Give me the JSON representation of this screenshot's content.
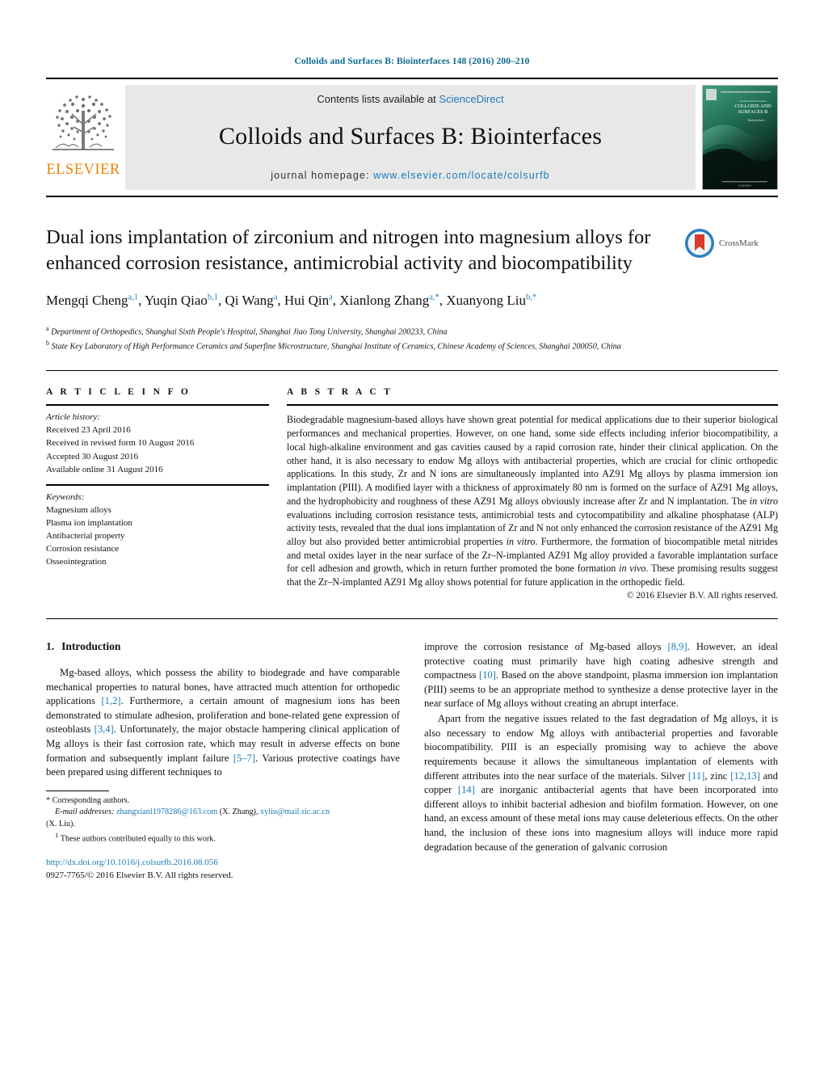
{
  "running_head": "Colloids and Surfaces B: Biointerfaces 148 (2016) 200–210",
  "masthead": {
    "publisher_name": "ELSEVIER",
    "contents_prefix": "Contents lists available at ",
    "contents_link": "ScienceDirect",
    "journal_name": "Colloids and Surfaces B: Biointerfaces",
    "homepage_prefix": "journal homepage: ",
    "homepage_url": "www.elsevier.com/locate/colsurfb",
    "cover_title_line1": "COLLOIDS AND",
    "cover_title_line2": "SURFACES B",
    "link_color": "#1a7bb9",
    "band_color": "#e8e8e8",
    "elsevier_orange": "#ef8200",
    "cover_green": "#0d3c2d"
  },
  "article": {
    "title": "Dual ions implantation of zirconium and nitrogen into magnesium alloys for enhanced corrosion resistance, antimicrobial activity and biocompatibility",
    "crossmark_label": "CrossMark",
    "authors": [
      {
        "name": "Mengqi Cheng",
        "marks": "a,1",
        "sep": ", "
      },
      {
        "name": "Yuqin Qiao",
        "marks": "b,1",
        "sep": ", "
      },
      {
        "name": "Qi Wang",
        "marks": "a",
        "sep": ", "
      },
      {
        "name": "Hui Qin",
        "marks": "a",
        "sep": ", "
      },
      {
        "name": "Xianlong Zhang",
        "marks": "a,*",
        "sep": ", "
      },
      {
        "name": "Xuanyong Liu",
        "marks": "b,*",
        "sep": ""
      }
    ],
    "affiliations": [
      {
        "mark": "a",
        "text": "Department of Orthopedics, Shanghai Sixth People's Hospital, Shanghai Jiao Tong University, Shanghai 200233, China"
      },
      {
        "mark": "b",
        "text": "State Key Laboratory of High Performance Ceramics and Superfine Microstructure, Shanghai Institute of Ceramics, Chinese Academy of Sciences, Shanghai 200050, China"
      }
    ]
  },
  "article_info": {
    "heading": "A R T I C L E    I N F O",
    "history_label": "Article history:",
    "history": [
      "Received 23 April 2016",
      "Received in revised form 10 August 2016",
      "Accepted 30 August 2016",
      "Available online 31 August 2016"
    ],
    "keywords_label": "Keywords:",
    "keywords": [
      "Magnesium alloys",
      "Plasma ion implantation",
      "Antibacterial property",
      "Corrosion resistance",
      "Osseointegration"
    ]
  },
  "abstract": {
    "heading": "A B S T R A C T",
    "paragraphs": [
      "Biodegradable magnesium-based alloys have shown great potential for medical applications due to their superior biological performances and mechanical properties. However, on one hand, some side effects including inferior biocompatibility, a local high-alkaline environment and gas cavities caused by a rapid corrosion rate, hinder their clinical application. On the other hand, it is also necessary to endow Mg alloys with antibacterial properties, which are crucial for clinic orthopedic applications. In this study, Zr and N ions are simultaneously implanted into AZ91 Mg alloys by plasma immersion ion implantation (PIII). A modified layer with a thickness of approximately 80 nm is formed on the surface of AZ91 Mg alloys, and the hydrophobicity and roughness of these AZ91 Mg alloys obviously increase after Zr and N implantation. The in vitro evaluations including corrosion resistance tests, antimicrobial tests and cytocompatibility and alkaline phosphatase (ALP) activity tests, revealed that the dual ions implantation of Zr and N not only enhanced the corrosion resistance of the AZ91 Mg alloy but also provided better antimicrobial properties in vitro. Furthermore, the formation of biocompatible metal nitrides and metal oxides layer in the near surface of the Zr–N-implanted AZ91 Mg alloy provided a favorable implantation surface for cell adhesion and growth, which in return further promoted the bone formation in vivo. These promising results suggest that the Zr–N-implanted AZ91 Mg alloy shows potential for future application in the orthopedic field."
    ],
    "copyright": "© 2016 Elsevier B.V. All rights reserved."
  },
  "body": {
    "section_number": "1.",
    "section_title": "Introduction",
    "left_paragraphs": [
      "Mg-based alloys, which possess the ability to biodegrade and have comparable mechanical properties to natural bones, have attracted much attention for orthopedic applications [1,2]. Furthermore, a certain amount of magnesium ions has been demonstrated to stimulate adhesion, proliferation and bone-related gene expression of osteoblasts [3,4]. Unfortunately, the major obstacle hampering clinical application of Mg alloys is their fast corrosion rate, which may result in adverse effects on bone formation and subsequently implant failure [5–7]. Various protective coatings have been prepared using different techniques to"
    ],
    "right_paragraphs": [
      "improve the corrosion resistance of Mg-based alloys [8,9]. However, an ideal protective coating must primarily have high coating adhesive strength and compactness [10]. Based on the above standpoint, plasma immersion ion implantation (PIII) seems to be an appropriate method to synthesize a dense protective layer in the near surface of Mg alloys without creating an abrupt interface.",
      "Apart from the negative issues related to the fast degradation of Mg alloys, it is also necessary to endow Mg alloys with antibacterial properties and favorable biocompatibility. PIII is an especially promising way to achieve the above requirements because it allows the simultaneous implantation of elements with different attributes into the near surface of the materials. Silver [11], zinc [12,13] and copper [14] are inorganic antibacterial agents that have been incorporated into different alloys to inhibit bacterial adhesion and biofilm formation. However, on one hand, an excess amount of these metal ions may cause deleterious effects. On the other hand, the inclusion of these ions into magnesium alloys will induce more rapid degradation because of the generation of galvanic corrosion"
    ]
  },
  "footnotes": {
    "corresponding_label": "Corresponding authors.",
    "email_label": "E-mail addresses:",
    "email1": "zhangxianl1978286@163.com",
    "email1_owner": "(X. Zhang),",
    "email2": "xyliu@mail.sic.ac.cn",
    "email2_owner": "(X. Liu).",
    "equal_contrib_marker": "1",
    "equal_contrib": "These authors contributed equally to this work.",
    "doi": "http://dx.doi.org/10.1016/j.colsurfb.2016.08.056",
    "issn_line": "0927-7765/© 2016 Elsevier B.V. All rights reserved."
  }
}
